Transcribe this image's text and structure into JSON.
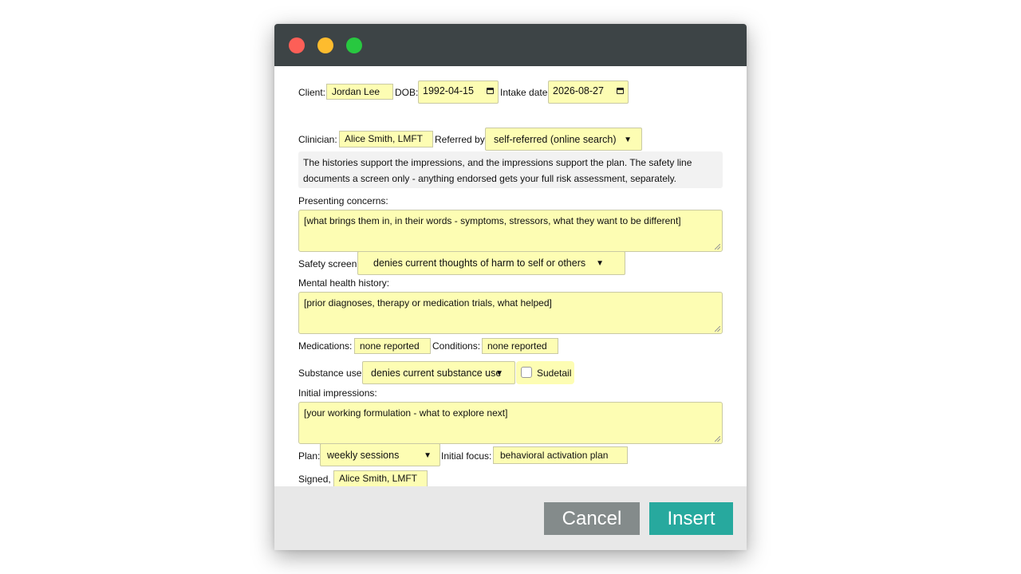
{
  "form": {
    "client_label": "Client:",
    "client_value": "Jordan Lee",
    "dob_label": "DOB:",
    "dob_value": "1992-04-15",
    "intake_label": "Intake date:",
    "intake_value": "2026-08-27",
    "clinician_label": "Clinician:",
    "clinician_value": "Alice Smith, LMFT",
    "referred_label": "Referred by:",
    "referred_value": "self-referred (online search)",
    "note": "The histories support the impressions, and the impressions support the plan. The safety line documents a screen only - anything endorsed gets your full risk assessment, separately.",
    "presenting_label": "Presenting concerns:",
    "presenting_value": "[what brings them in, in their words - symptoms, stressors, what they want to be different]",
    "safety_label": "Safety screen:",
    "safety_value": "denies current thoughts of harm to self or others",
    "mh_history_label": "Mental health history:",
    "mh_history_value": "[prior diagnoses, therapy or medication trials, what helped]",
    "medications_label": "Medications:",
    "medications_value": "none reported",
    "conditions_label": "Conditions:",
    "conditions_value": "none reported",
    "substance_label": "Substance use:",
    "substance_value": "denies current substance use",
    "sudetail_label": "Sudetail",
    "impressions_label": "Initial impressions:",
    "impressions_value": "[your working formulation - what to explore next]",
    "plan_label": "Plan:",
    "plan_value": "weekly sessions",
    "focus_label": "Initial focus:",
    "focus_value": "behavioral activation plan",
    "signed_label": "Signed,",
    "signed_value": "Alice Smith, LMFT"
  },
  "footer": {
    "cancel_label": "Cancel",
    "insert_label": "Insert"
  },
  "colors": {
    "field_bg": "#fdfdb3",
    "titlebar": "#3d4446",
    "cancel": "#848b8b",
    "insert": "#27a99e"
  }
}
